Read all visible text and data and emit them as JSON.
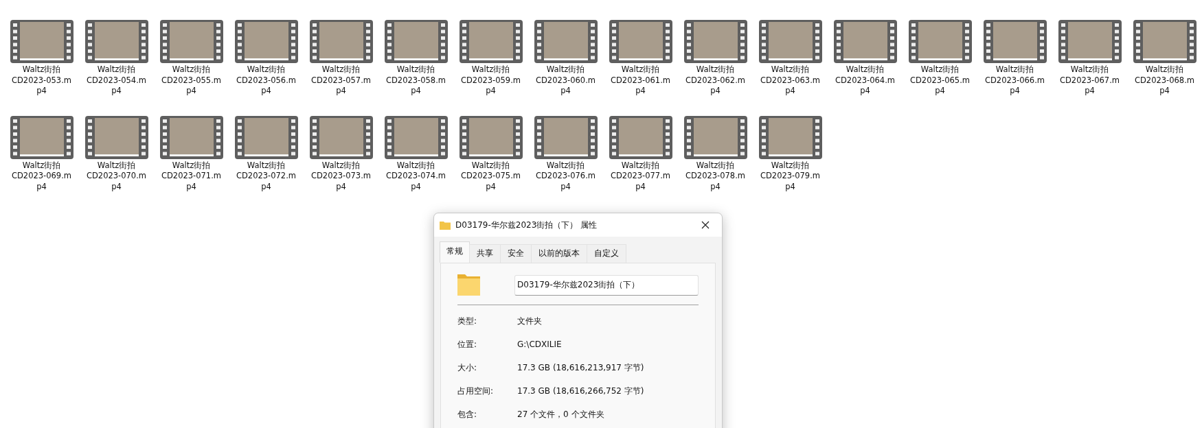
{
  "files": [
    {
      "lines": [
        "Waltz街拍",
        "CD2023-053.m",
        "p4"
      ]
    },
    {
      "lines": [
        "Waltz街拍",
        "CD2023-054.m",
        "p4"
      ]
    },
    {
      "lines": [
        "Waltz街拍",
        "CD2023-055.m",
        "p4"
      ]
    },
    {
      "lines": [
        "Waltz街拍",
        "CD2023-056.m",
        "p4"
      ]
    },
    {
      "lines": [
        "Waltz街拍",
        "CD2023-057.m",
        "p4"
      ]
    },
    {
      "lines": [
        "Waltz街拍",
        "CD2023-058.m",
        "p4"
      ]
    },
    {
      "lines": [
        "Waltz街拍",
        "CD2023-059.m",
        "p4"
      ]
    },
    {
      "lines": [
        "Waltz街拍",
        "CD2023-060.m",
        "p4"
      ]
    },
    {
      "lines": [
        "Waltz街拍",
        "CD2023-061.m",
        "p4"
      ]
    },
    {
      "lines": [
        "Waltz街拍",
        "CD2023-062.m",
        "p4"
      ]
    },
    {
      "lines": [
        "Waltz街拍",
        "CD2023-063.m",
        "p4"
      ]
    },
    {
      "lines": [
        "Waltz街拍",
        "CD2023-064.m",
        "p4"
      ]
    },
    {
      "lines": [
        "Waltz街拍",
        "CD2023-065.m",
        "p4"
      ]
    },
    {
      "lines": [
        "Waltz街拍",
        "CD2023-066.m",
        "p4"
      ]
    },
    {
      "lines": [
        "Waltz街拍",
        "CD2023-067.m",
        "p4"
      ]
    },
    {
      "lines": [
        "Waltz街拍",
        "CD2023-068.m",
        "p4"
      ]
    },
    {
      "lines": [
        "Waltz街拍",
        "CD2023-069.m",
        "p4"
      ]
    },
    {
      "lines": [
        "Waltz街拍",
        "CD2023-070.m",
        "p4"
      ]
    },
    {
      "lines": [
        "Waltz街拍",
        "CD2023-071.m",
        "p4"
      ]
    },
    {
      "lines": [
        "Waltz街拍",
        "CD2023-072.m",
        "p4"
      ]
    },
    {
      "lines": [
        "Waltz街拍",
        "CD2023-073.m",
        "p4"
      ]
    },
    {
      "lines": [
        "Waltz街拍",
        "CD2023-074.m",
        "p4"
      ]
    },
    {
      "lines": [
        "Waltz街拍",
        "CD2023-075.m",
        "p4"
      ]
    },
    {
      "lines": [
        "Waltz街拍",
        "CD2023-076.m",
        "p4"
      ]
    },
    {
      "lines": [
        "Waltz街拍",
        "CD2023-077.m",
        "p4"
      ]
    },
    {
      "lines": [
        "Waltz街拍",
        "CD2023-078.m",
        "p4"
      ]
    },
    {
      "lines": [
        "Waltz街拍",
        "CD2023-079.m",
        "p4"
      ]
    }
  ],
  "dialog": {
    "title": "D03179-华尔兹2023街拍（下） 属性",
    "tabs": [
      {
        "label": "常规",
        "selected": true
      },
      {
        "label": "共享",
        "selected": false
      },
      {
        "label": "安全",
        "selected": false
      },
      {
        "label": "以前的版本",
        "selected": false
      },
      {
        "label": "自定义",
        "selected": false
      }
    ],
    "name_field": {
      "value": "D03179-华尔兹2023街拍（下）"
    },
    "properties": [
      {
        "label": "类型:",
        "value": "文件夹"
      },
      {
        "label": "位置:",
        "value": "G:\\CDXILIE"
      },
      {
        "label": "大小:",
        "value": "17.3 GB (18,616,213,917 字节)"
      },
      {
        "label": "占用空间:",
        "value": "17.3 GB (18,616,266,752 字节)"
      },
      {
        "label": "包含:",
        "value": "27 个文件，0 个文件夹"
      }
    ]
  }
}
